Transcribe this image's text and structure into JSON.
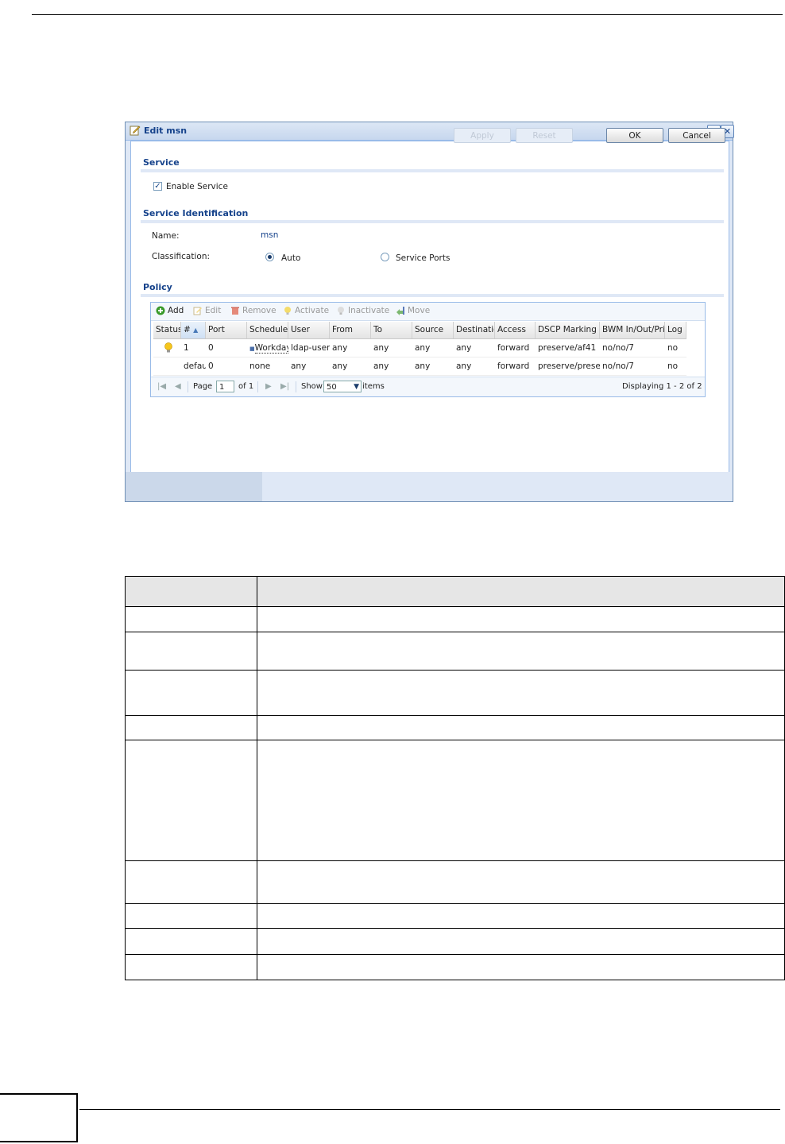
{
  "dialog": {
    "title": "Edit msn",
    "help_label": "?",
    "close_label": "✕",
    "sections": {
      "service": "Service",
      "identification": "Service Identification",
      "policy": "Policy"
    },
    "enable_service_label": "Enable Service",
    "enable_service_checked": true,
    "name_label": "Name:",
    "name_value": "msn",
    "classification_label": "Classification:",
    "classification_options": [
      "Auto",
      "Service Ports"
    ],
    "classification_selected": "Auto"
  },
  "toolbar": {
    "add": "Add",
    "edit": "Edit",
    "remove": "Remove",
    "activate": "Activate",
    "inactivate": "Inactivate",
    "move": "Move"
  },
  "grid": {
    "columns": [
      "Status",
      "#",
      "Port",
      "Schedule",
      "User",
      "From",
      "To",
      "Source",
      "Destinatio",
      "Access",
      "DSCP Marking In",
      "BWM In/Out/Pri",
      "Log"
    ],
    "rows": [
      {
        "status_icon": "lightbulb-on-icon",
        "num": "1",
        "port": "0",
        "schedule": "Workday",
        "user": "ldap-users",
        "from": "any",
        "to": "any",
        "source": "any",
        "destination": "any",
        "access": "forward",
        "dscp": "preserve/af41",
        "bwm": "no/no/7",
        "log": "no"
      },
      {
        "status_icon": "",
        "num": "defau",
        "port": "0",
        "schedule": "none",
        "user": "any",
        "from": "any",
        "to": "any",
        "source": "any",
        "destination": "any",
        "access": "forward",
        "dscp": "preserve/preser",
        "bwm": "no/no/7",
        "log": "no"
      }
    ]
  },
  "pager": {
    "page_label": "Page",
    "page_value": "1",
    "of_label": "of 1",
    "show_label": "Show",
    "show_value": "50",
    "items_label": "items",
    "displaying": "Displaying 1 - 2 of 2"
  },
  "footer": {
    "apply": "Apply",
    "reset": "Reset",
    "ok": "OK",
    "cancel": "Cancel"
  }
}
